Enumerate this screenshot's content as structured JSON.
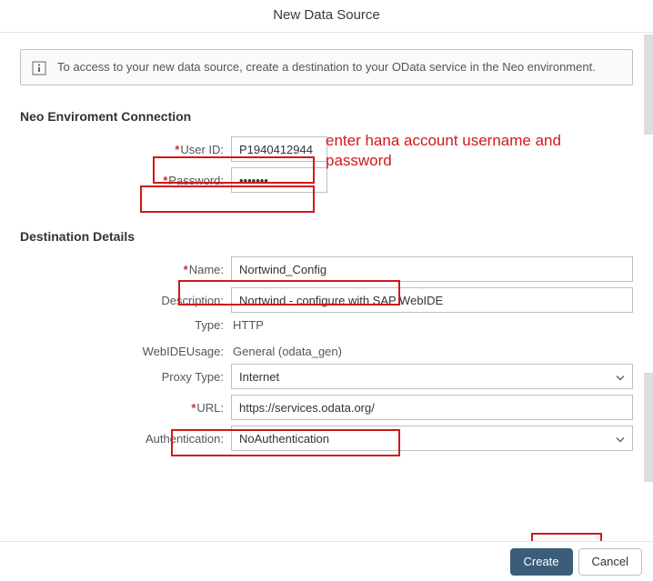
{
  "dialog": {
    "title": "New Data Source"
  },
  "infobox": {
    "message": "To access to your new data source, create a destination to your OData service in the Neo environment."
  },
  "sections": {
    "neo_title": "Neo Enviroment Connection",
    "dest_title": "Destination Details"
  },
  "neo": {
    "user_id_label": "User ID:",
    "user_id_value": "P1940412944",
    "password_label": "Password:",
    "password_value": "•••••••"
  },
  "dest": {
    "name_label": "Name:",
    "name_value": "Nortwind_Config",
    "description_label": "Description:",
    "description_value": "Nortwind - configure with SAP WebIDE",
    "type_label": "Type:",
    "type_value": "HTTP",
    "webideusage_label": "WebIDEUsage:",
    "webideusage_value": "General (odata_gen)",
    "proxy_label": "Proxy Type:",
    "proxy_value": "Internet",
    "url_label": "URL:",
    "url_value": "https://services.odata.org/",
    "auth_label": "Authentication:",
    "auth_value": "NoAuthentication"
  },
  "footer": {
    "create_label": "Create",
    "cancel_label": "Cancel"
  },
  "annotation": {
    "text": "enter hana account username and password"
  }
}
